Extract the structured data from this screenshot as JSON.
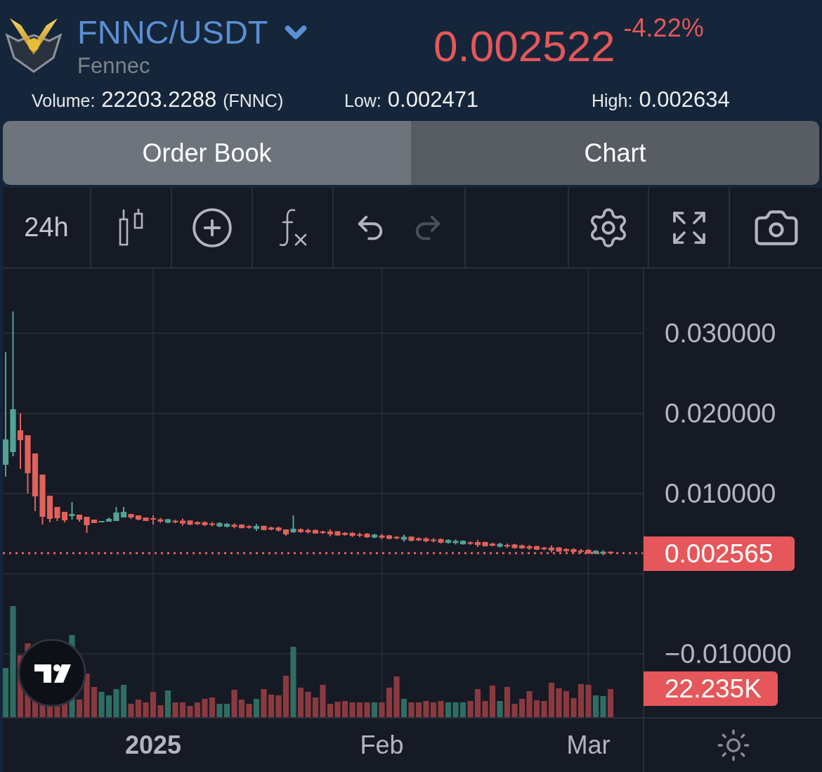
{
  "header": {
    "pair": "FNNC/USDT",
    "name": "Fennec",
    "price": "0.002522",
    "change": "-4.22%"
  },
  "stats": [
    {
      "label": "Volume:",
      "value": "22203.2288",
      "unit": "(FNNC)"
    },
    {
      "label": "Low:",
      "value": "0.002471"
    },
    {
      "label": "High:",
      "value": "0.002634"
    }
  ],
  "tabs": [
    {
      "label": "Order Book",
      "selected": false
    },
    {
      "label": "Chart",
      "selected": true
    }
  ],
  "toolbar": {
    "interval": "24h",
    "undo": {
      "disabled": false
    },
    "redo": {
      "disabled": true
    }
  },
  "chart": {
    "chart_data": {
      "type": "candlestick",
      "categories": [
        null,
        null,
        null,
        null,
        null,
        null,
        null,
        null,
        null,
        null,
        null,
        null,
        null,
        null,
        null,
        null,
        null,
        null,
        null,
        null,
        "2025",
        null,
        null,
        null,
        null,
        null,
        null,
        null,
        null,
        null,
        null,
        null,
        null,
        null,
        null,
        null,
        null,
        null,
        null,
        null,
        null,
        null,
        null,
        null,
        null,
        null,
        null,
        null,
        null,
        null,
        null,
        "Feb",
        null,
        null,
        null,
        null,
        null,
        null,
        null,
        null,
        null,
        null,
        null,
        null,
        null,
        null,
        null,
        null,
        null,
        null,
        null,
        null,
        null,
        null,
        null,
        null,
        null,
        null,
        null,
        "Mar",
        null,
        null,
        null
      ],
      "ohlc": [
        [
          0.013596,
          0.027632,
          0.012105,
          0.016754
        ],
        [
          0.015175,
          0.032719,
          0.014649,
          0.020526
        ],
        [
          0.017895,
          0.02,
          0.01307,
          0.016667
        ],
        [
          0.017281,
          0.017281,
          0.01,
          0.012544
        ],
        [
          0.015,
          0.015,
          0.007807,
          0.009649
        ],
        [
          0.012368,
          0.012368,
          0.00614,
          0.007105
        ],
        [
          0.009737,
          0.009737,
          0.006404,
          0.006842
        ],
        [
          0.008333,
          0.008333,
          0.006579,
          0.00693
        ],
        [
          0.007719,
          0.007719,
          0.006404,
          0.006667
        ],
        [
          0.007193,
          0.008947,
          0.006754,
          0.007456
        ],
        [
          0.007368,
          0.007368,
          0.006491,
          0.006754
        ],
        [
          0.007105,
          0.007105,
          0.005088,
          0.006053
        ],
        [
          0.006754,
          0.006754,
          0.006316,
          0.006316
        ],
        [
          0.006404,
          0.006579,
          0.006404,
          0.006579
        ],
        [
          0.006491,
          0.007018,
          0.006491,
          0.006842
        ],
        [
          0.006579,
          0.008333,
          0.006579,
          0.007632
        ],
        [
          0.007018,
          0.008333,
          0.007018,
          0.007719
        ],
        [
          0.007456,
          0.007456,
          0.006842,
          0.007018
        ],
        [
          0.007281,
          0.007281,
          0.006667,
          0.006754
        ],
        [
          0.007018,
          0.007018,
          0.006579,
          0.006579
        ],
        [
          0.00693,
          0.007281,
          0.00614,
          0.006754
        ],
        [
          0.00678,
          0.00696,
          0.00634,
          0.00652
        ],
        [
          0.006363,
          0.006843,
          0.006323,
          0.006803
        ],
        [
          0.006606,
          0.006736,
          0.006296,
          0.006426
        ],
        [
          0.006628,
          0.006888,
          0.006008,
          0.006268
        ],
        [
          0.006641,
          0.006681,
          0.006081,
          0.006121
        ],
        [
          0.006444,
          0.006534,
          0.006094,
          0.006184
        ],
        [
          0.006427,
          0.006557,
          0.005937,
          0.006067
        ],
        [
          0.00627,
          0.00645,
          0.00591,
          0.00609
        ],
        [
          0.005892,
          0.006422,
          0.005802,
          0.006332
        ],
        [
          0.005865,
          0.006315,
          0.005775,
          0.006225
        ],
        [
          0.006108,
          0.006288,
          0.005668,
          0.005848
        ],
        [
          0.006131,
          0.006171,
          0.005651,
          0.005691
        ],
        [
          0.005934,
          0.006064,
          0.005624,
          0.005754
        ],
        [
          0.005596,
          0.006216,
          0.005336,
          0.005956
        ],
        [
          0.005969,
          0.006009,
          0.005409,
          0.005449
        ],
        [
          0.005772,
          0.005862,
          0.005422,
          0.005512
        ],
        [
          0.005755,
          0.005885,
          0.005265,
          0.005395
        ],
        [
          0.005526,
          0.005526,
          0.004737,
          0.004912
        ],
        [
          0.005175,
          0.007281,
          0.005088,
          0.005614
        ],
        [
          0.005553,
          0.005643,
          0.005103,
          0.005193
        ],
        [
          0.005436,
          0.005616,
          0.004996,
          0.005176
        ],
        [
          0.005459,
          0.005499,
          0.004979,
          0.005019
        ],
        [
          0.005262,
          0.005392,
          0.004952,
          0.005082
        ],
        [
          0.005284,
          0.005544,
          0.004664,
          0.004924
        ],
        [
          0.005297,
          0.005337,
          0.004737,
          0.004777
        ],
        [
          0.0051,
          0.00519,
          0.00475,
          0.00484
        ],
        [
          0.005083,
          0.005213,
          0.004593,
          0.004723
        ],
        [
          0.004926,
          0.005106,
          0.004566,
          0.004746
        ],
        [
          0.004988,
          0.005078,
          0.004458,
          0.004548
        ],
        [
          0.004521,
          0.004971,
          0.004431,
          0.004881
        ],
        [
          0.004764,
          0.004944,
          0.004324,
          0.004504
        ],
        [
          0.004787,
          0.004827,
          0.004307,
          0.004347
        ],
        [
          0.00459,
          0.00472,
          0.00428,
          0.00441
        ],
        [
          0.004252,
          0.004872,
          0.003992,
          0.004612
        ],
        [
          0.004625,
          0.004665,
          0.004065,
          0.004105
        ],
        [
          0.004428,
          0.004518,
          0.004078,
          0.004168
        ],
        [
          0.004411,
          0.004541,
          0.003921,
          0.004051
        ],
        [
          0.004254,
          0.004434,
          0.003894,
          0.004074
        ],
        [
          0.004316,
          0.004406,
          0.003786,
          0.003876
        ],
        [
          0.003849,
          0.004299,
          0.003759,
          0.004209
        ],
        [
          0.003832,
          0.004272,
          0.003652,
          0.004092
        ],
        [
          0.003675,
          0.004155,
          0.003635,
          0.004115
        ],
        [
          0.003918,
          0.004048,
          0.003608,
          0.003738
        ],
        [
          0.00394,
          0.0042,
          0.00332,
          0.00358
        ],
        [
          0.003953,
          0.003993,
          0.003393,
          0.003433
        ],
        [
          0.003756,
          0.003846,
          0.003406,
          0.003496
        ],
        [
          0.003379,
          0.003869,
          0.003249,
          0.003739
        ],
        [
          0.003582,
          0.003762,
          0.003222,
          0.003402
        ],
        [
          0.003644,
          0.003734,
          0.003114,
          0.003204
        ],
        [
          0.003537,
          0.003627,
          0.003087,
          0.003177
        ],
        [
          0.00342,
          0.0036,
          0.00298,
          0.00316
        ],
        [
          0.003443,
          0.003483,
          0.002963,
          0.003003
        ],
        [
          0.003246,
          0.003376,
          0.002936,
          0.003066
        ],
        [
          0.003268,
          0.003528,
          0.002648,
          0.002908
        ],
        [
          0.003281,
          0.003321,
          0.002721,
          0.002761
        ],
        [
          0.003084,
          0.003174,
          0.002734,
          0.002824
        ],
        [
          0.003067,
          0.003197,
          0.002577,
          0.002707
        ],
        [
          0.00291,
          0.00309,
          0.00255,
          0.00273
        ],
        [
          0.002972,
          0.003062,
          0.002442,
          0.002532
        ],
        [
          0.002505,
          0.002955,
          0.002415,
          0.002865
        ],
        [
          0.002488,
          0.002928,
          0.002308,
          0.002748
        ],
        [
          0.002745,
          0.002785,
          0.002525,
          0.002565
        ]
      ],
      "ylim": [
        -0.017895,
        0.03807
      ],
      "yticks": [
        {
          "value": 0.03,
          "label": "0.030000"
        },
        {
          "value": 0.02,
          "label": "0.020000"
        },
        {
          "value": 0.01,
          "label": "0.010000"
        },
        {
          "value": -0.01,
          "label": "−0.010000"
        }
      ],
      "grid": true,
      "ref_lines": [
        {
          "axis": "y",
          "value": 0.002565,
          "label": "0.002565"
        }
      ]
    },
    "xtick_bold": [
      true,
      false,
      false
    ],
    "volume_label": "22.235K"
  }
}
